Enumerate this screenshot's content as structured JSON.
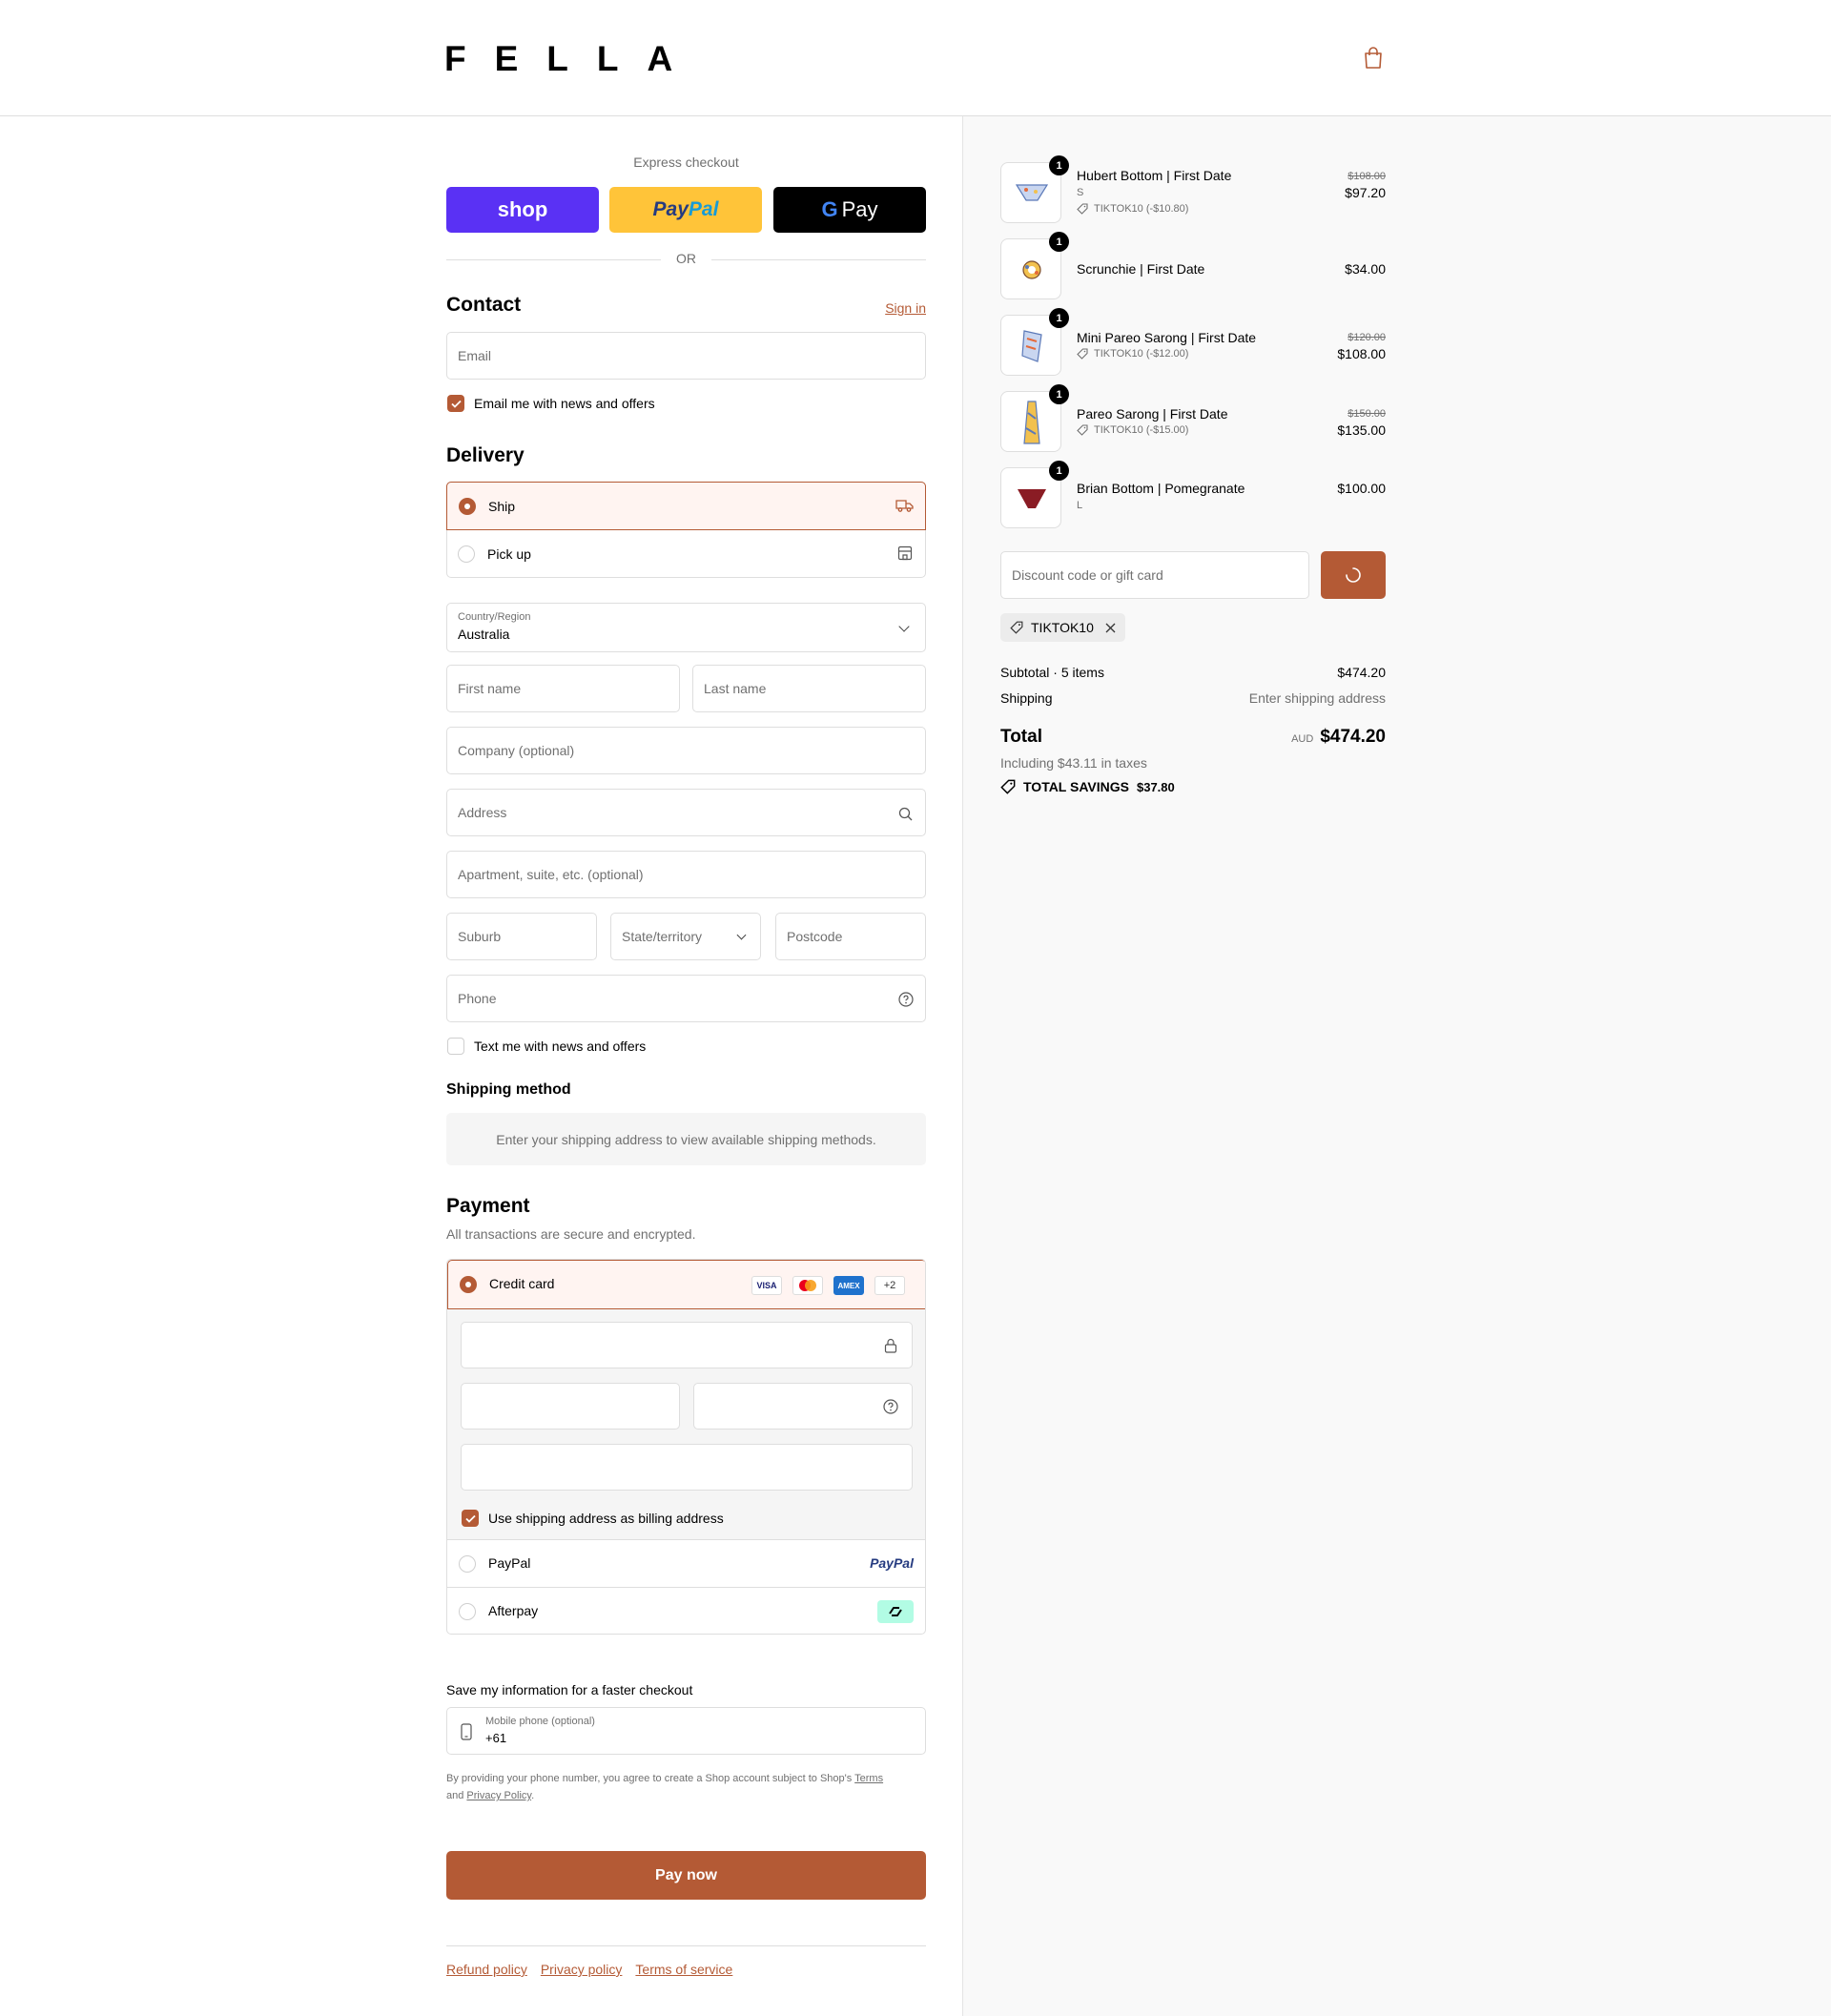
{
  "brand": {
    "logo": "FELLA",
    "accent_color": "#b45a35"
  },
  "header": {
    "cart_icon": "shopping-bag-icon"
  },
  "express": {
    "label": "Express checkout",
    "buttons": [
      {
        "label": "shop",
        "color": "#5a31f4"
      },
      {
        "label": "PayPal",
        "color": "#ffc439"
      },
      {
        "label": "G Pay",
        "color": "#000000"
      }
    ],
    "or": "OR"
  },
  "contact": {
    "title": "Contact",
    "sign_in": "Sign in",
    "email_placeholder": "Email",
    "news_label": "Email me with news and offers",
    "news_checked": true
  },
  "delivery": {
    "title": "Delivery",
    "options": [
      {
        "label": "Ship",
        "selected": true,
        "icon": "truck-icon"
      },
      {
        "label": "Pick up",
        "selected": false,
        "icon": "store-icon"
      }
    ],
    "country_label": "Country/Region",
    "country_value": "Australia",
    "first_name": "First name",
    "last_name": "Last name",
    "company": "Company (optional)",
    "address": "Address",
    "apartment": "Apartment, suite, etc. (optional)",
    "suburb": "Suburb",
    "state": "State/territory",
    "postcode": "Postcode",
    "phone": "Phone",
    "text_label": "Text me with news and offers",
    "text_checked": false
  },
  "shipping_method": {
    "title": "Shipping method",
    "notice": "Enter your shipping address to view available shipping methods."
  },
  "payment": {
    "title": "Payment",
    "subtitle": "All transactions are secure and encrypted.",
    "credit_card": "Credit card",
    "card_logos": [
      "VISA",
      "MC",
      "AMEX",
      "+2"
    ],
    "billing_label": "Use shipping address as billing address",
    "billing_checked": true,
    "paypal": "PayPal",
    "paypal_logo": "PayPal",
    "afterpay": "Afterpay"
  },
  "save_info": {
    "title": "Save my information for a faster checkout",
    "mobile_label": "Mobile phone (optional)",
    "mobile_value": "+61",
    "legal_prefix": "By providing your phone number, you agree to create a Shop account subject to Shop's",
    "terms": "Terms",
    "and": "and",
    "privacy": "Privacy Policy",
    "period": "."
  },
  "pay_now": "Pay now",
  "footer": {
    "links": [
      "Refund policy",
      "Privacy policy",
      "Terms of service"
    ]
  },
  "cart": {
    "items": [
      {
        "name": "Hubert Bottom | First Date",
        "variant": "S",
        "discount": "TIKTOK10 (-$10.80)",
        "original": "$108.00",
        "price": "$97.20",
        "qty": "1"
      },
      {
        "name": "Scrunchie | First Date",
        "variant": "",
        "discount": "",
        "original": "",
        "price": "$34.00",
        "qty": "1"
      },
      {
        "name": "Mini Pareo Sarong | First Date",
        "variant": "",
        "discount": "TIKTOK10 (-$12.00)",
        "original": "$120.00",
        "price": "$108.00",
        "qty": "1"
      },
      {
        "name": "Pareo Sarong | First Date",
        "variant": "",
        "discount": "TIKTOK10 (-$15.00)",
        "original": "$150.00",
        "price": "$135.00",
        "qty": "1"
      },
      {
        "name": "Brian Bottom | Pomegranate",
        "variant": "L",
        "discount": "",
        "original": "",
        "price": "$100.00",
        "qty": "1"
      }
    ],
    "discount_placeholder": "Discount code or gift card",
    "applied_code": "TIKTOK10",
    "subtotal_label": "Subtotal · 5 items",
    "subtotal_value": "$474.20",
    "shipping_label": "Shipping",
    "shipping_value": "Enter shipping address",
    "total_label": "Total",
    "currency": "AUD",
    "total_value": "$474.20",
    "taxes": "Including $43.11 in taxes",
    "savings_label": "TOTAL SAVINGS",
    "savings_value": "$37.80"
  }
}
